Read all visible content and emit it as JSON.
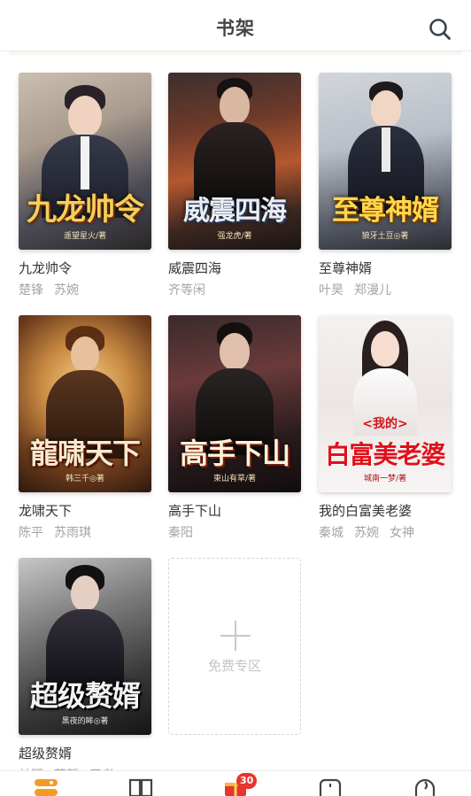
{
  "header": {
    "title": "书架",
    "search_icon": "search-icon"
  },
  "books": [
    {
      "name": "九龙帅令",
      "cover_title": "九龙帅令",
      "cover_author": "遥望星火/著",
      "tags": [
        "楚锋",
        "苏婉"
      ]
    },
    {
      "name": "威震四海",
      "cover_title": "威震四海",
      "cover_author": "强龙虎/著",
      "tags": [
        "齐等闲"
      ]
    },
    {
      "name": "至尊神婿",
      "cover_title": "至尊神婿",
      "cover_author": "狼牙土豆◎著",
      "tags": [
        "叶昊",
        "郑漫儿"
      ]
    },
    {
      "name": "龙啸天下",
      "cover_title": "龍啸天下",
      "cover_author": "韩三千◎著",
      "tags": [
        "陈平",
        "苏雨琪"
      ]
    },
    {
      "name": "高手下山",
      "cover_title": "高手下山",
      "cover_author": "東山有草/著",
      "tags": [
        "秦阳"
      ]
    },
    {
      "name": "我的白富美老婆",
      "cover_title": "白富美老婆",
      "cover_title_top": "<我的>",
      "cover_author": "城南一梦/著",
      "tags": [
        "秦城",
        "苏婉",
        "女神"
      ]
    },
    {
      "name": "超级赘婿",
      "cover_title": "超级赘婿",
      "cover_author": "黑夜的眸◎著",
      "tags": [
        "林阳",
        "苏颜",
        "王者"
      ]
    }
  ],
  "add_slot": {
    "label": "免费专区"
  },
  "tabbar": {
    "items": [
      {
        "icon": "bookshelf-icon",
        "active": true
      },
      {
        "icon": "book-store-icon",
        "active": false
      },
      {
        "icon": "gift-icon",
        "active": false,
        "badge": "30"
      },
      {
        "icon": "category-icon",
        "active": false
      },
      {
        "icon": "profile-icon",
        "active": false
      }
    ]
  },
  "colors": {
    "accent": "#f59a23",
    "badge": "#e8352d"
  }
}
